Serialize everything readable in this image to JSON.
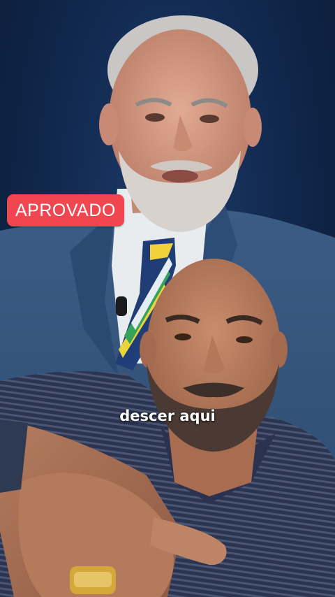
{
  "overlay": {
    "badge_label": "APROVADO",
    "caption_text": "descer aqui"
  },
  "colors": {
    "background": "#10264a",
    "badge": "#f0464f",
    "caption_text": "#ffffff"
  }
}
